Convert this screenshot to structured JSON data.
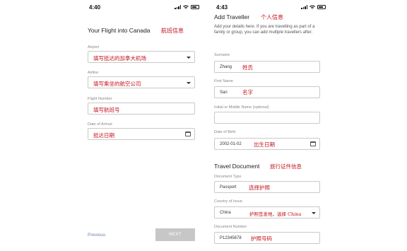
{
  "left_screen": {
    "time": "4:40",
    "heading": "Your Flight into Canada",
    "heading_cn": "航班信息",
    "airport": {
      "label": "Airport",
      "value": "填写抵达的加拿大机场"
    },
    "airline": {
      "label": "Airline",
      "value": "填写乘坐的航空公司"
    },
    "flight_number": {
      "label": "Flight Number",
      "value": "填写航班号"
    },
    "date_of_arrival": {
      "label": "Date of Arrival",
      "value": "抵达日期"
    },
    "previous_label": "Previous",
    "next_label": "NEXT"
  },
  "right_screen": {
    "time": "4:43",
    "heading": "Add Traveller",
    "heading_cn": "个人信息",
    "description": "Add your details here. If you are travelling as part of a family or group, you can add multiple travellers after.",
    "surname": {
      "label": "Surname",
      "value": "Zhang",
      "note": "姓氏"
    },
    "first_name": {
      "label": "First Name",
      "value": "San",
      "note": "名字"
    },
    "middle_name": {
      "label": "Initial or Middle Name (optional)",
      "value": ""
    },
    "date_of_birth": {
      "label": "Date of Birth",
      "value": "2002-01-02",
      "note": "出生日期"
    },
    "travel_doc_heading": "Travel Document",
    "travel_doc_heading_cn": "旅行证件信息",
    "document_type": {
      "label": "Document Type",
      "value": "Passport",
      "note": "选择护照"
    },
    "country_of_issue": {
      "label": "Country of Issue",
      "value": "China",
      "note": "护照签发地，选择 China"
    },
    "document_number": {
      "label": "Document Number",
      "value": "P12345678",
      "note": "护照号码"
    }
  }
}
